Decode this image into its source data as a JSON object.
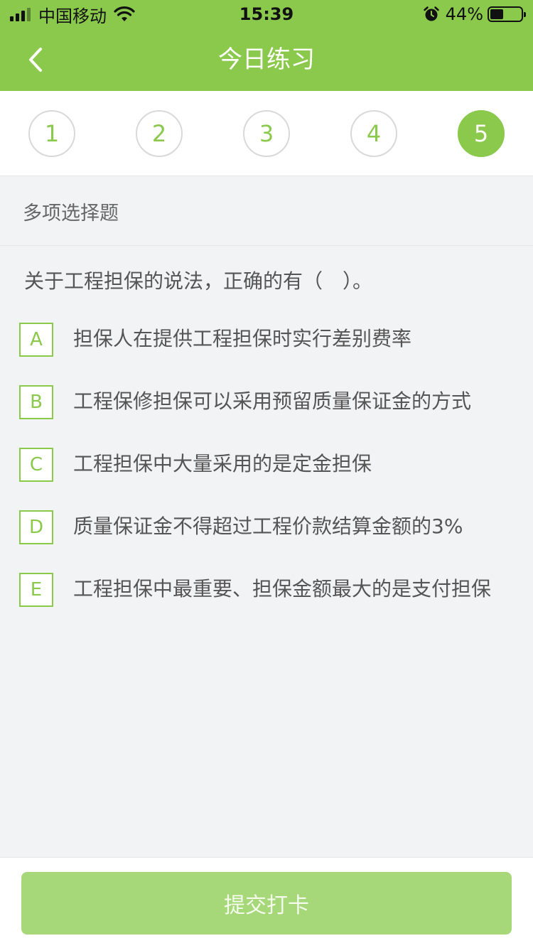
{
  "status_bar": {
    "carrier": "中国移动",
    "time": "15:39",
    "battery": "44%",
    "battery_level": 0.44,
    "icons": [
      "signal-icon",
      "wifi-icon",
      "alarm-icon",
      "battery-icon"
    ]
  },
  "nav": {
    "title": "今日练习",
    "back_icon": "chevron-left-icon"
  },
  "stepper": {
    "steps": [
      "1",
      "2",
      "3",
      "4",
      "5"
    ],
    "active_index": 4
  },
  "question": {
    "type_label": "多项选择题",
    "text": "关于工程担保的说法，正确的有（　）。",
    "options": [
      {
        "letter": "A",
        "text": "担保人在提供工程担保时实行差别费率"
      },
      {
        "letter": "B",
        "text": "工程保修担保可以采用预留质量保证金的方式"
      },
      {
        "letter": "C",
        "text": "工程担保中大量采用的是定金担保"
      },
      {
        "letter": "D",
        "text": "质量保证金不得超过工程价款结算金额的3%"
      },
      {
        "letter": "E",
        "text": "工程担保中最重要、担保金额最大的是支付担保"
      }
    ]
  },
  "footer": {
    "submit_label": "提交打卡"
  },
  "colors": {
    "accent": "#8bc94d",
    "button_disabled": "#a6d879",
    "background": "#f2f3f5",
    "text": "#555555"
  }
}
